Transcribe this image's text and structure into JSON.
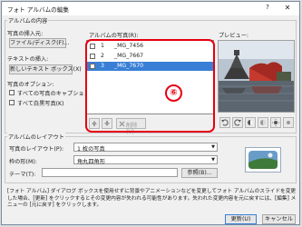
{
  "window": {
    "title": "フォト アルバムの編集",
    "help": "?",
    "close": "✕"
  },
  "album_content": {
    "group_title": "アルバムの内容",
    "insert_picture_label": "写真の挿入元:",
    "file_disk_button": "ファイル/ディスク(F)...",
    "insert_text_label": "テキストの挿入:",
    "new_textbox_button": "新しいテキスト ボックス(X)",
    "picture_options_label": "写真のオプション:",
    "caption_checkbox": "すべての写真のキャプション(A)",
    "bw_checkbox": "すべて白黒写真(K)"
  },
  "picture_list": {
    "label": "アルバムの写真(R):",
    "items": [
      {
        "num": "1",
        "name": "_MG_7456",
        "checked": false,
        "selected": false
      },
      {
        "num": "2",
        "name": "_MG_7667",
        "checked": false,
        "selected": false
      },
      {
        "num": "3",
        "name": "_MG_7670",
        "checked": false,
        "selected": true
      }
    ],
    "remove_button": "削除(V)",
    "annotation_number": "⑥"
  },
  "preview": {
    "label": "プレビュー:"
  },
  "album_layout": {
    "group_title": "アルバムのレイアウト",
    "picture_layout_label": "写真のレイアウト(P):",
    "picture_layout_value": "1 枚の写真",
    "frame_shape_label": "枠の形(M):",
    "frame_shape_value": "角丸四角形",
    "theme_label": "テーマ(T):",
    "theme_value": "",
    "browse_button": "参照(B)..."
  },
  "note": "[フォト アルバム] ダイアログ ボックスを使用せずに背景やアニメーションなどを変更してフォト アルバムのスライドを変更した場合、[更新] をクリックするとその変更内容が失われる可能性があります。失われた変更内容を元に戻すには、[編集] メニューの [元に戻す] をクリックします。",
  "footer": {
    "update_button": "更新(U)",
    "cancel_button": "キャンセル"
  },
  "colors": {
    "selection": "#3a7fd6",
    "annotation": "#e60012"
  }
}
